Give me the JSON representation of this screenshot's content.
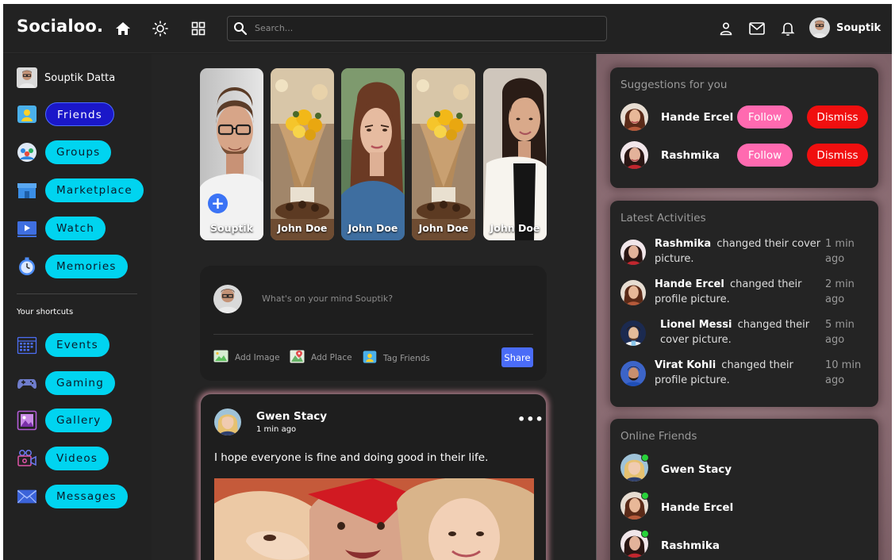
{
  "app": {
    "logo": "Socialoo."
  },
  "header": {
    "search_placeholder": "Search...",
    "user_name": "Souptik",
    "icons": [
      "home-icon",
      "brightness-icon",
      "grid-icon",
      "search-icon",
      "person-icon",
      "mail-icon",
      "bell-icon"
    ]
  },
  "sidebar": {
    "profile_name": "Souptik Datta",
    "items": [
      {
        "label": "Friends",
        "icon": "friends-icon",
        "active": true
      },
      {
        "label": "Groups",
        "icon": "groups-icon"
      },
      {
        "label": "Marketplace",
        "icon": "marketplace-icon"
      },
      {
        "label": "Watch",
        "icon": "watch-icon"
      },
      {
        "label": "Memories",
        "icon": "memories-icon"
      }
    ],
    "shortcuts_title": "Your shortcuts",
    "shortcuts": [
      {
        "label": "Events",
        "icon": "events-icon"
      },
      {
        "label": "Gaming",
        "icon": "gaming-icon"
      },
      {
        "label": "Gallery",
        "icon": "gallery-icon"
      },
      {
        "label": "Videos",
        "icon": "videos-icon"
      },
      {
        "label": "Messages",
        "icon": "messages-icon"
      }
    ]
  },
  "stories": [
    {
      "name": "Souptik",
      "own": true
    },
    {
      "name": "John Doe"
    },
    {
      "name": "John Doe"
    },
    {
      "name": "John Doe"
    },
    {
      "name": "John Doe"
    }
  ],
  "composer": {
    "placeholder": "What's on your mind Souptik?",
    "add_image": "Add Image",
    "add_place": "Add Place",
    "tag_friends": "Tag Friends",
    "share": "Share"
  },
  "post": {
    "author": "Gwen Stacy",
    "time": "1 min ago",
    "more": "•••",
    "text": "I hope everyone is fine and doing good in their life."
  },
  "suggestions": {
    "title": "Suggestions for you",
    "follow_label": "Follow",
    "dismiss_label": "Dismiss",
    "people": [
      {
        "name": "Hande Ercel"
      },
      {
        "name": "Rashmika"
      }
    ]
  },
  "activities": {
    "title": "Latest Activities",
    "items": [
      {
        "name": "Rashmika",
        "action": "changed their cover picture.",
        "time": "1 min ago"
      },
      {
        "name": "Hande Ercel",
        "action": "changed their profile picture.",
        "time": "2 min ago"
      },
      {
        "name": "Lionel Messi",
        "action": "changed their cover picture.",
        "time": "5 min ago"
      },
      {
        "name": "Virat Kohli",
        "action": "changed their profile picture.",
        "time": "10 min ago"
      }
    ]
  },
  "online": {
    "title": "Online Friends",
    "friends": [
      {
        "name": "Gwen Stacy"
      },
      {
        "name": "Hande Ercel"
      },
      {
        "name": "Rashmika"
      }
    ]
  },
  "colors": {
    "accent_pill": "#00d4f0",
    "active_pill": "#1a17c9",
    "follow": "#ff6ab0",
    "dismiss": "#f00f0f",
    "share": "#4a6cf7",
    "online_dot": "#28d33a"
  }
}
